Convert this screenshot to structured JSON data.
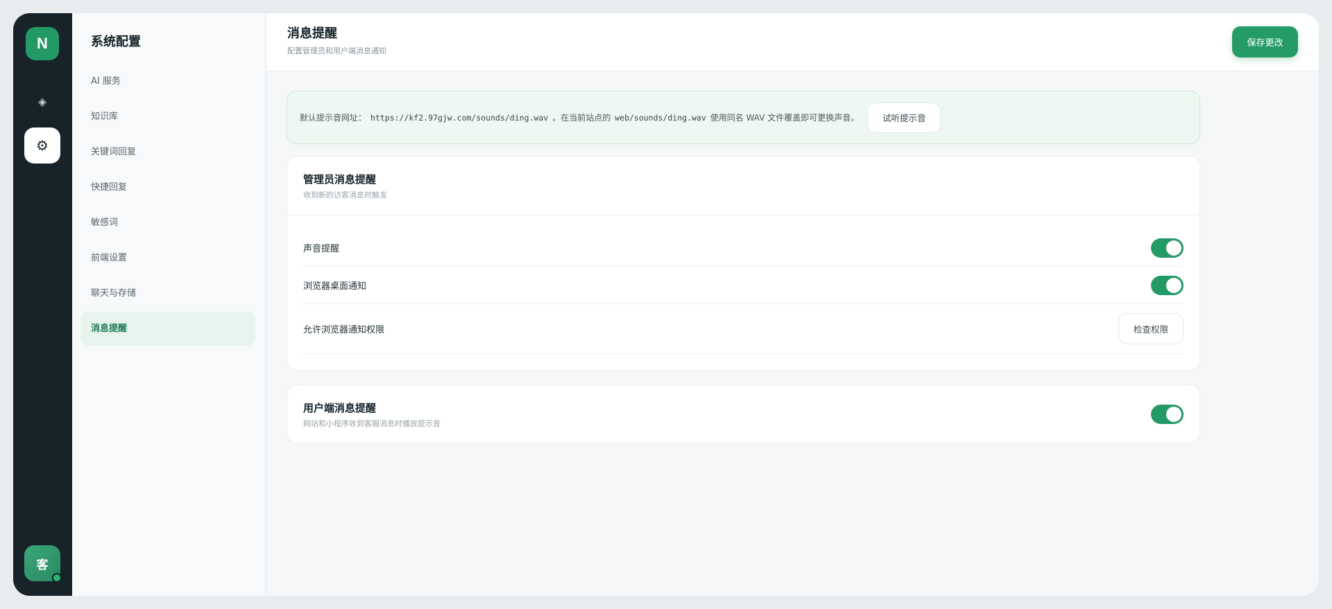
{
  "rail": {
    "logo": "N",
    "avatar": "客"
  },
  "nav": {
    "title": "系统配置",
    "items": [
      {
        "label": "AI 服务"
      },
      {
        "label": "知识库"
      },
      {
        "label": "关键词回复"
      },
      {
        "label": "快捷回复"
      },
      {
        "label": "敏感词"
      },
      {
        "label": "前端设置"
      },
      {
        "label": "聊天与存储"
      },
      {
        "label": "消息提醒",
        "active": true
      }
    ]
  },
  "header": {
    "title": "消息提醒",
    "subtitle": "配置管理员和用户端消息通知",
    "save_label": "保存更改"
  },
  "notice": {
    "prefix": "默认提示音网址：",
    "url": "https://kf2.97gjw.com/sounds/ding.wav",
    "middle": "。在当前站点的",
    "path": "web/sounds/ding.wav",
    "suffix": "使用同名 WAV 文件覆盖即可更换声音。",
    "listen_label": "试听提示音"
  },
  "admin_card": {
    "title": "管理员消息提醒",
    "subtitle": "收到新的访客消息时触发",
    "rows": [
      {
        "label": "声音提醒",
        "enabled": true
      },
      {
        "label": "浏览器桌面通知",
        "enabled": true
      },
      {
        "label": "允许浏览器通知权限",
        "button": "检查权限"
      }
    ]
  },
  "user_card": {
    "title": "用户端消息提醒",
    "subtitle": "网站和小程序收到客服消息时播放提示音",
    "enabled": true
  },
  "colors": {
    "accent": "#239a66",
    "rail_bg": "#172329",
    "active_bg": "#e7f4ed",
    "notice_bg": "#eef7f1"
  }
}
